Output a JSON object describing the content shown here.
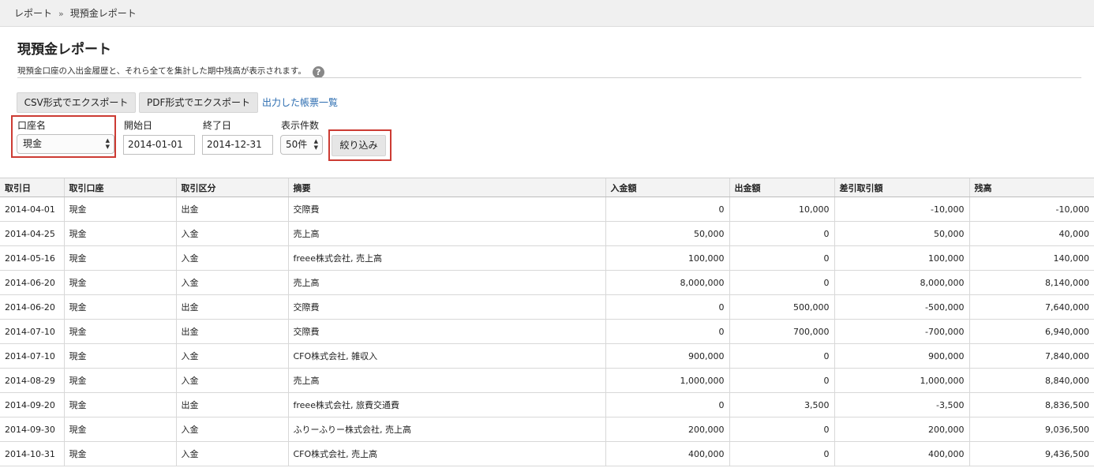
{
  "breadcrumb": {
    "root": "レポート",
    "separator": "»",
    "current": "現預金レポート"
  },
  "page": {
    "title": "現預金レポート",
    "description": "現預金口座の入出金履歴と、それら全てを集計した期中残高が表示されます。",
    "help_glyph": "?"
  },
  "toolbar": {
    "csv_export": "CSV形式でエクスポート",
    "pdf_export": "PDF形式でエクスポート",
    "report_list_link": "出力した帳票一覧"
  },
  "filters": {
    "account": {
      "label": "口座名",
      "value": "現金"
    },
    "start_date": {
      "label": "開始日",
      "value": "2014-01-01"
    },
    "end_date": {
      "label": "終了日",
      "value": "2014-12-31"
    },
    "page_size": {
      "label": "表示件数",
      "value": "50件"
    },
    "apply_button": "絞り込み"
  },
  "table": {
    "columns": [
      "取引日",
      "取引口座",
      "取引区分",
      "摘要",
      "入金額",
      "出金額",
      "差引取引額",
      "残高"
    ],
    "rows": [
      [
        "2014-04-01",
        "現金",
        "出金",
        "交際費",
        "0",
        "10,000",
        "-10,000",
        "-10,000"
      ],
      [
        "2014-04-25",
        "現金",
        "入金",
        "売上高",
        "50,000",
        "0",
        "50,000",
        "40,000"
      ],
      [
        "2014-05-16",
        "現金",
        "入金",
        "freee株式会社, 売上高",
        "100,000",
        "0",
        "100,000",
        "140,000"
      ],
      [
        "2014-06-20",
        "現金",
        "入金",
        "売上高",
        "8,000,000",
        "0",
        "8,000,000",
        "8,140,000"
      ],
      [
        "2014-06-20",
        "現金",
        "出金",
        "交際費",
        "0",
        "500,000",
        "-500,000",
        "7,640,000"
      ],
      [
        "2014-07-10",
        "現金",
        "出金",
        "交際費",
        "0",
        "700,000",
        "-700,000",
        "6,940,000"
      ],
      [
        "2014-07-10",
        "現金",
        "入金",
        "CFO株式会社, 雑収入",
        "900,000",
        "0",
        "900,000",
        "7,840,000"
      ],
      [
        "2014-08-29",
        "現金",
        "入金",
        "売上高",
        "1,000,000",
        "0",
        "1,000,000",
        "8,840,000"
      ],
      [
        "2014-09-20",
        "現金",
        "出金",
        "freee株式会社, 旅費交通費",
        "0",
        "3,500",
        "-3,500",
        "8,836,500"
      ],
      [
        "2014-09-30",
        "現金",
        "入金",
        "ふりーふりー株式会社, 売上高",
        "200,000",
        "0",
        "200,000",
        "9,036,500"
      ],
      [
        "2014-10-31",
        "現金",
        "入金",
        "CFO株式会社, 売上高",
        "400,000",
        "0",
        "400,000",
        "9,436,500"
      ]
    ]
  },
  "colors": {
    "highlight": "#cc3b33",
    "link": "#2b6cb0"
  }
}
